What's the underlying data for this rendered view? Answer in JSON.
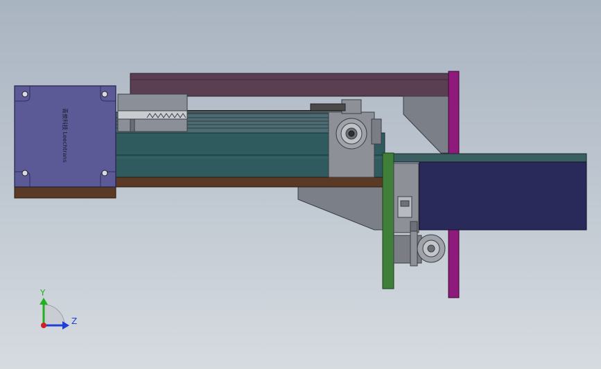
{
  "model_view": {
    "motor_label": "青泉科技 Leechtrans",
    "colors": {
      "background_top": "#a9b4c1",
      "background_bottom": "#d6dbe0",
      "motor_body": "#5c5a96",
      "top_frame": "#5a3e52",
      "magenta_plate": "#8e1a7c",
      "green_plate": "#3f7f3a",
      "rail": "#2f5a5e",
      "base_bar": "#5a3a24",
      "dark_block": "#2a2a5a",
      "bracket_grey": "#7a7f88",
      "bearing_grey": "#8d9096"
    }
  },
  "triad": {
    "y_label": "Y",
    "z_label": "Z",
    "y_color": "#22b022",
    "z_color": "#1f3fd8",
    "origin_color": "#d02020"
  }
}
